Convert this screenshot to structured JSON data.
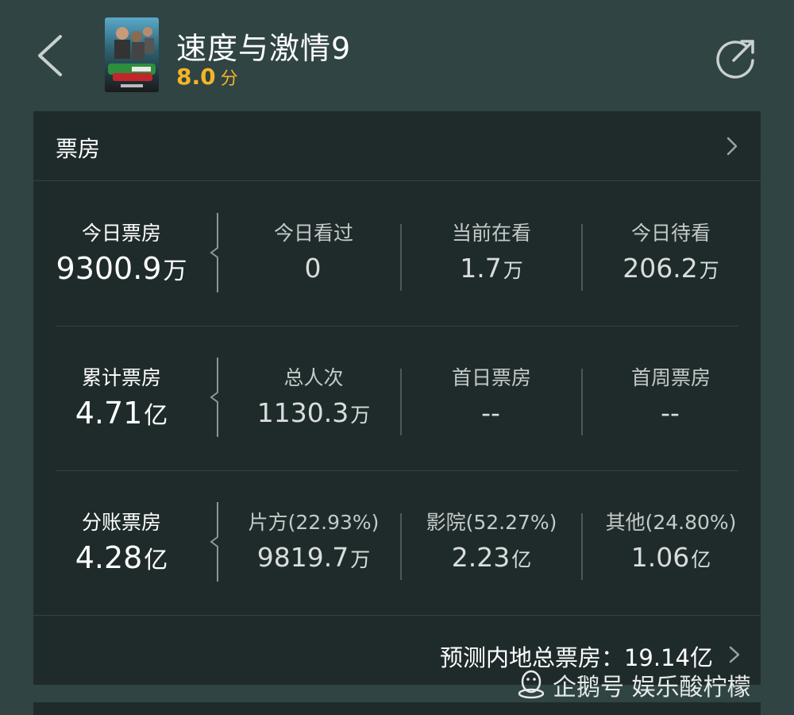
{
  "header": {
    "title": "速度与激情9",
    "rating_value": "8.0",
    "rating_unit": "分",
    "accent_color": "#f5b427",
    "back_icon": "chevron-left-icon",
    "share_icon": "share-icon"
  },
  "box_office": {
    "title": "票房",
    "rows": [
      {
        "main": {
          "label": "今日票房",
          "value": "9300.9",
          "unit": "万"
        },
        "cells": [
          {
            "label": "今日看过",
            "value": "0",
            "unit": ""
          },
          {
            "label": "当前在看",
            "value": "1.7",
            "unit": "万"
          },
          {
            "label": "今日待看",
            "value": "206.2",
            "unit": "万"
          }
        ]
      },
      {
        "main": {
          "label": "累计票房",
          "value": "4.71",
          "unit": "亿"
        },
        "cells": [
          {
            "label": "总人次",
            "value": "1130.3",
            "unit": "万"
          },
          {
            "label": "首日票房",
            "value": "--",
            "unit": ""
          },
          {
            "label": "首周票房",
            "value": "--",
            "unit": ""
          }
        ]
      },
      {
        "main": {
          "label": "分账票房",
          "value": "4.28",
          "unit": "亿"
        },
        "cells": [
          {
            "label": "片方(22.93%)",
            "value": "9819.7",
            "unit": "万"
          },
          {
            "label": "影院(52.27%)",
            "value": "2.23",
            "unit": "亿"
          },
          {
            "label": "其他(24.80%)",
            "value": "1.06",
            "unit": "亿"
          }
        ]
      }
    ],
    "forecast": "预测内地总票房：19.14亿"
  },
  "watermark": {
    "text": "企鹅号 娱乐酸柠檬",
    "icon": "qq-penguin-icon"
  }
}
